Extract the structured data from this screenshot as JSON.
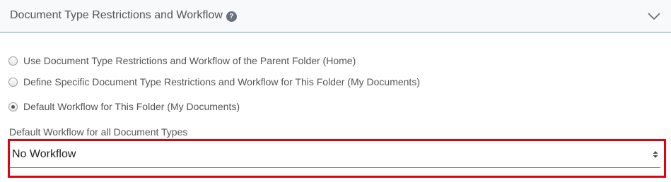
{
  "panel": {
    "title": "Document Type Restrictions and Workflow",
    "help_glyph": "?",
    "help_icon": "help-icon",
    "collapse_icon": "chevron-down-icon"
  },
  "options": [
    {
      "label": "Use Document Type Restrictions and Workflow of the Parent Folder (Home)",
      "checked": false
    },
    {
      "label": "Define Specific Document Type Restrictions and Workflow for This Folder (My Documents)",
      "checked": false
    },
    {
      "label": "Default Workflow for This Folder (My Documents)",
      "checked": true
    }
  ],
  "workflow_field": {
    "label": "Default Workflow for all Document Types",
    "selected_value": "No Workflow",
    "arrow_icon": "select-arrows-icon"
  },
  "colors": {
    "highlight": "#e3000f",
    "header_bg": "#f7f9fa",
    "header_border": "#b9d2dc",
    "text": "#555555"
  }
}
